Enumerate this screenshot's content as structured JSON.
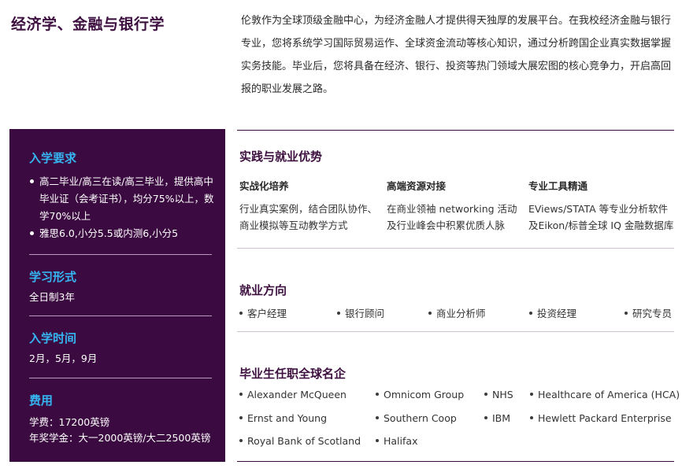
{
  "title": "经济学、金融与银行学",
  "intro": "伦敦作为全球顶级金融中心，为经济金融人才提供得天独厚的发展平台。在我校经济金融与银行专业，您将系统学习国际贸易运作、全球资金流动等核心知识，通过分析跨国企业真实数据掌握实务技能。毕业后，您将具备在经济、银行、投资等热门领域大展宏图的核心竞争力，开启高回报的职业发展之路。",
  "sidebar": {
    "requirements": {
      "heading": "入学要求",
      "items": [
        "高二毕业/高三在读/高三毕业，提供高中毕业证（会考证书），均分75%以上，数学70%以上",
        "雅思6.0,小分5.5或内测6,小分5"
      ]
    },
    "study_mode": {
      "heading": "学习形式",
      "text": "全日制3年"
    },
    "intake": {
      "heading": "入学时间",
      "text": "2月，5月，9月"
    },
    "fees": {
      "heading": "费用",
      "tuition": "学费：17200英镑",
      "scholarship": "年奖学金：大一2000英镑/大二2500英镑"
    }
  },
  "practice": {
    "heading": "实践与就业优势",
    "columns": [
      {
        "title": "实战化培养",
        "text": "行业真实案例，结合团队协作、商业模拟等互动教学方式"
      },
      {
        "title": "高端资源对接",
        "text": "在商业领袖 networking 活动及行业峰会中积累优质人脉"
      },
      {
        "title": "专业工具精通",
        "text": "EViews/STATA 等专业分析软件及Eikon/标普全球 IQ 金融数据库"
      }
    ]
  },
  "careers": {
    "heading": "就业方向",
    "items": [
      "客户经理",
      "银行顾问",
      "商业分析师",
      "投资经理",
      "研究专员"
    ]
  },
  "employers": {
    "heading": "毕业生任职全球名企",
    "items": [
      "Alexander McQueen",
      "Omnicom Group",
      "NHS",
      "Healthcare of America (HCA)",
      "Ernst and Young",
      "Southern Coop",
      "IBM",
      "Hewlett Packard Enterprise",
      "Royal Bank of Scotland",
      "Halifax"
    ]
  }
}
